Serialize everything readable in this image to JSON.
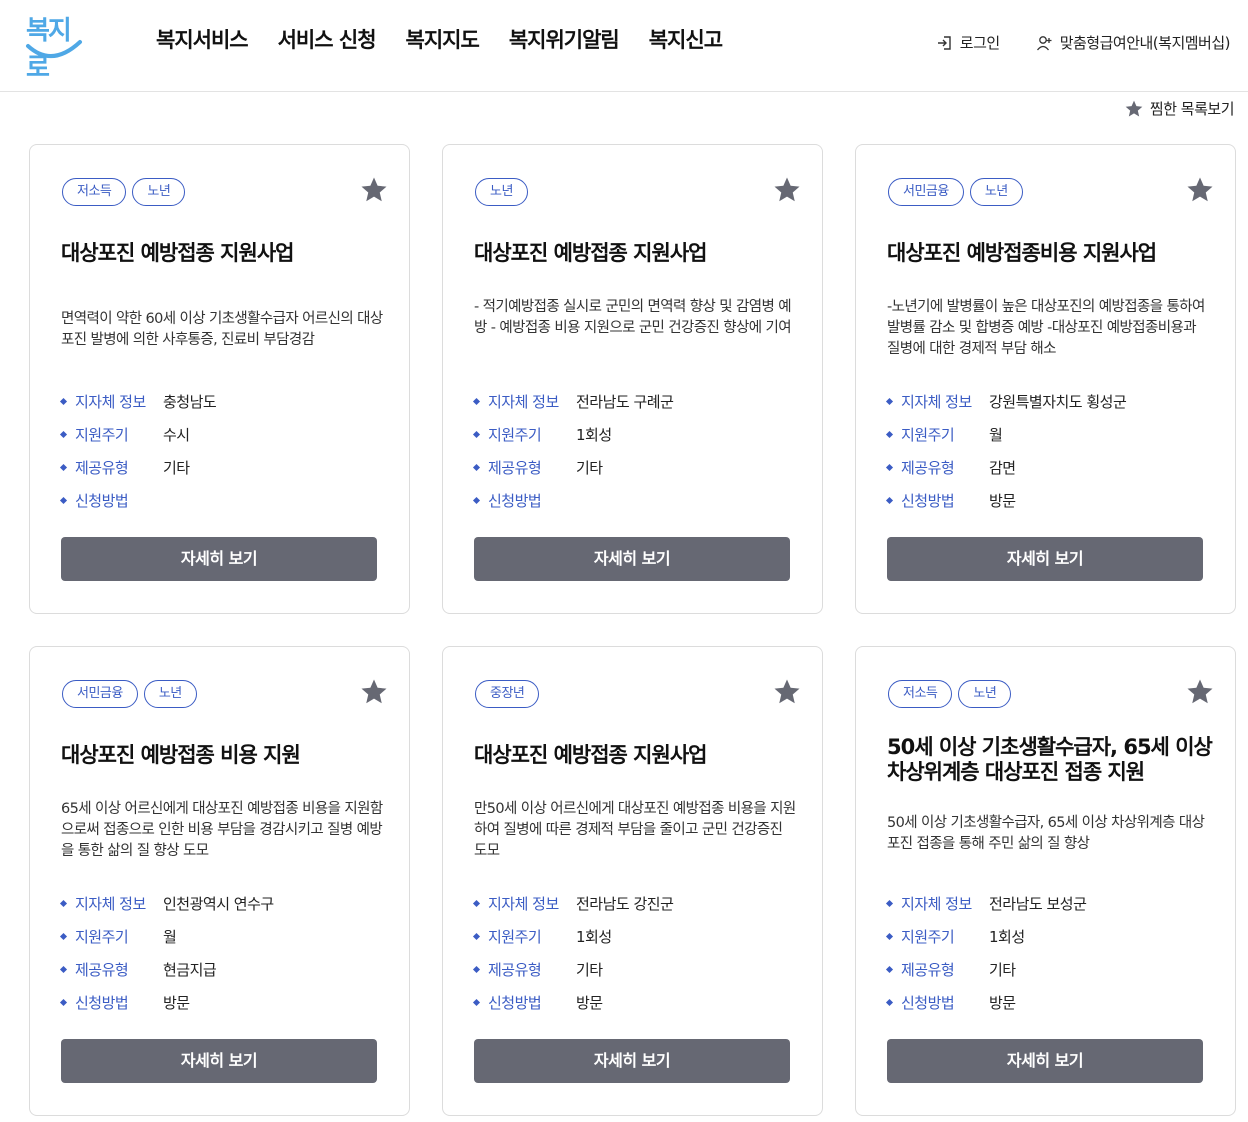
{
  "header": {
    "logo_text": "복지로",
    "nav": [
      "복지서비스",
      "서비스 신청",
      "복지지도",
      "복지위기알림",
      "복지신고"
    ],
    "login": "로그인",
    "membership": "맞춤형급여안내(복지멤버십)"
  },
  "favorites_link": "찜한 목록보기",
  "labels": {
    "region": "지자체 정보",
    "cycle": "지원주기",
    "type": "제공유형",
    "method": "신청방법",
    "detail_button": "자세히 보기"
  },
  "cards": [
    {
      "tags": [
        "저소득",
        "노년"
      ],
      "title": "대상포진 예방접종 지원사업",
      "desc": "면역력이 약한 60세 이상 기초생활수급자 어르신의 대상포진 발병에 의한 사후통증, 진료비 부담경감",
      "region": "충청남도",
      "cycle": "수시",
      "type": "기타",
      "method": ""
    },
    {
      "tags": [
        "노년"
      ],
      "title": "대상포진 예방접종 지원사업",
      "desc": "- 적기예방접종 실시로 군민의 면역력 향상 및 감염병 예방 - 예방접종 비용 지원으로 군민 건강증진 향상에 기여",
      "region": "전라남도 구례군",
      "cycle": "1회성",
      "type": "기타",
      "method": ""
    },
    {
      "tags": [
        "서민금융",
        "노년"
      ],
      "title": "대상포진 예방접종비용 지원사업",
      "desc": "-노년기에 발병률이 높은 대상포진의 예방접종을 통하여 발병률 감소 및 합병증 예방 -대상포진 예방접종비용과 질병에 대한 경제적 부담 해소",
      "region": "강원특별자치도 횡성군",
      "cycle": "월",
      "type": "감면",
      "method": "방문"
    },
    {
      "tags": [
        "서민금융",
        "노년"
      ],
      "title": "대상포진 예방접종 비용 지원",
      "desc": "65세 이상 어르신에게 대상포진 예방접종 비용을 지원함으로써 접종으로 인한 비용 부담을 경감시키고 질병 예방을 통한 삶의 질 향상 도모",
      "region": "인천광역시 연수구",
      "cycle": "월",
      "type": "현금지급",
      "method": "방문"
    },
    {
      "tags": [
        "중장년"
      ],
      "title": "대상포진 예방접종 지원사업",
      "desc": "만50세 이상 어르신에게 대상포진 예방접종 비용을 지원하여 질병에 따른 경제적 부담을 줄이고 군민 건강증진 도모",
      "region": "전라남도 강진군",
      "cycle": "1회성",
      "type": "기타",
      "method": "방문"
    },
    {
      "tags": [
        "저소득",
        "노년"
      ],
      "title": "50세 이상 기초생활수급자, 65세 이상 차상위계층 대상포진 접종 지원",
      "desc": "50세 이상 기초생활수급자, 65세 이상 차상위계층 대상포진 접종을 통해 주민 삶의 질 향상",
      "region": "전라남도 보성군",
      "cycle": "1회성",
      "type": "기타",
      "method": "방문"
    }
  ]
}
